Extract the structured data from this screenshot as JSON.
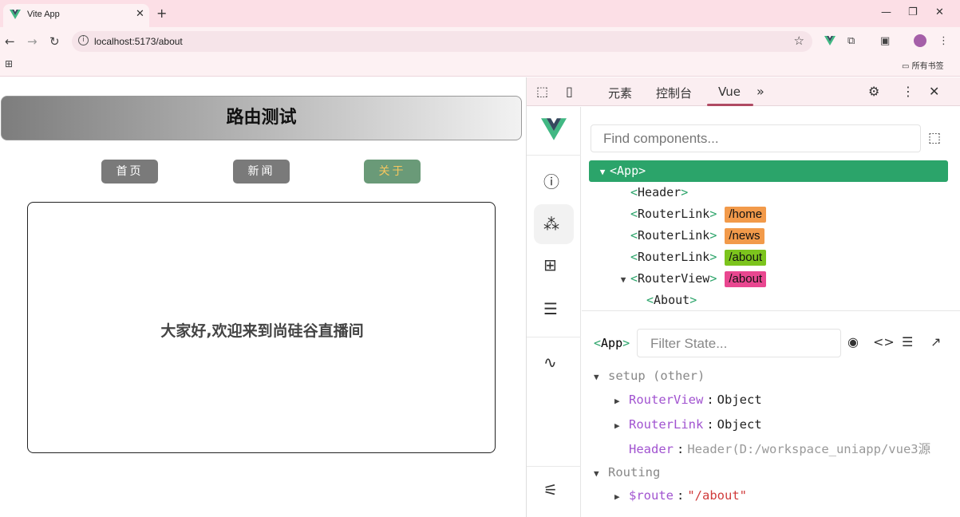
{
  "browser": {
    "tab_title": "Vite App",
    "new_tab": "+",
    "url": "localhost:5173/about",
    "bookmarks_folder": "所有书签"
  },
  "page": {
    "title": "路由测试",
    "nav": [
      {
        "label": "首页",
        "active": false
      },
      {
        "label": "新闻",
        "active": false
      },
      {
        "label": "关于",
        "active": true
      }
    ],
    "content": "大家好,欢迎来到尚硅谷直播间"
  },
  "devtools": {
    "tabs": [
      "元素",
      "控制台",
      "Vue"
    ],
    "active_tab": "Vue",
    "search_placeholder": "Find components...",
    "tree": [
      {
        "name": "App",
        "expanded": true,
        "selected": true,
        "tag": null
      },
      {
        "name": "Header",
        "tag": null
      },
      {
        "name": "RouterLink",
        "tag": "/home",
        "tag_color": "#f29a4a"
      },
      {
        "name": "RouterLink",
        "tag": "/news",
        "tag_color": "#f29a4a"
      },
      {
        "name": "RouterLink",
        "tag": "/about",
        "tag_color": "#7cc41d"
      },
      {
        "name": "RouterView",
        "expanded": true,
        "tag": "/about",
        "tag_color": "#e94790"
      },
      {
        "name": "About",
        "tag": null
      }
    ],
    "state_component": "App",
    "filter_placeholder": "Filter State...",
    "state": {
      "setup_group": "setup (other)",
      "rows": [
        {
          "key": "RouterView",
          "value": "Object"
        },
        {
          "key": "RouterLink",
          "value": "Object"
        },
        {
          "key": "Header",
          "value": "Header(D:/workspace_uniapp/vue3源"
        }
      ],
      "routing_group": "Routing",
      "route_key": "$route",
      "route_value": "\"/about\""
    }
  },
  "colors": {
    "vue_green": "#2ba46a",
    "active_nav_bg": "#6a9a78",
    "active_nav_text": "#f7c75e",
    "nav_bg": "#7a7a7a"
  }
}
